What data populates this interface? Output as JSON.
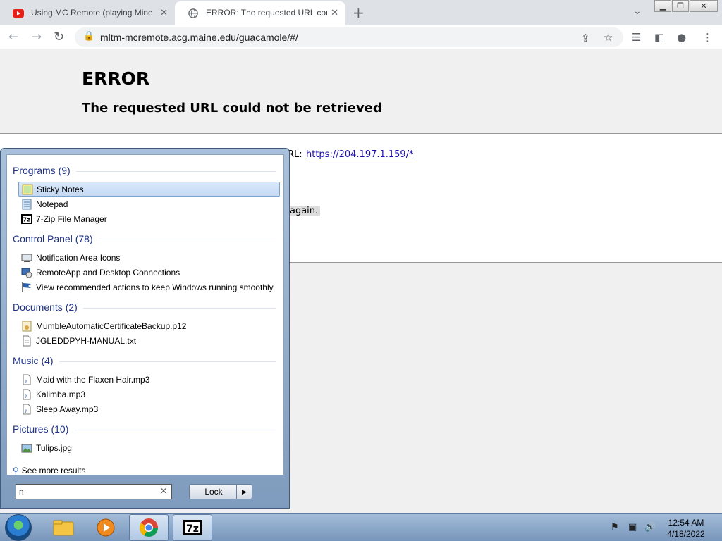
{
  "browser": {
    "tabs": [
      {
        "title": "Using MC Remote (playing Mine",
        "icon": "youtube-icon"
      },
      {
        "title": "ERROR: The requested URL could",
        "icon": "globe-icon"
      }
    ],
    "new_tab_label": "+",
    "url": "mltm-mcremote.acg.maine.edu/guacamole/#/"
  },
  "page": {
    "title": "ERROR",
    "subtitle": "The requested URL could not be retrieved",
    "body_prefix": "RL:",
    "body_link": "https://204.197.1.159/*",
    "again": "again."
  },
  "start_menu": {
    "groups": [
      {
        "header": "Programs (9)",
        "items": [
          {
            "label": "Sticky Notes",
            "icon": "sticky-notes-icon",
            "selected": true
          },
          {
            "label": "Notepad",
            "icon": "notepad-icon"
          },
          {
            "label": "7-Zip File Manager",
            "icon": "7zip-icon"
          }
        ]
      },
      {
        "header": "Control Panel (78)",
        "items": [
          {
            "label": "Notification Area Icons",
            "icon": "notification-area-icon"
          },
          {
            "label": "RemoteApp and Desktop Connections",
            "icon": "remoteapp-icon"
          },
          {
            "label": "View recommended actions to keep Windows running smoothly",
            "icon": "flag-icon"
          }
        ]
      },
      {
        "header": "Documents (2)",
        "items": [
          {
            "label": "MumbleAutomaticCertificateBackup.p12",
            "icon": "certificate-icon"
          },
          {
            "label": "JGLEDDPYH-MANUAL.txt",
            "icon": "text-file-icon"
          }
        ]
      },
      {
        "header": "Music (4)",
        "items": [
          {
            "label": "Maid with the Flaxen Hair.mp3",
            "icon": "music-file-icon"
          },
          {
            "label": "Kalimba.mp3",
            "icon": "music-file-icon"
          },
          {
            "label": "Sleep Away.mp3",
            "icon": "music-file-icon"
          }
        ]
      },
      {
        "header": "Pictures (10)",
        "items": [
          {
            "label": "Tulips.jpg",
            "icon": "image-file-icon"
          }
        ]
      }
    ],
    "see_more": "See more results",
    "search_value": "n",
    "lock_label": "Lock"
  },
  "taskbar": {
    "clock_time": "12:54 AM",
    "clock_date": "4/18/2022"
  }
}
